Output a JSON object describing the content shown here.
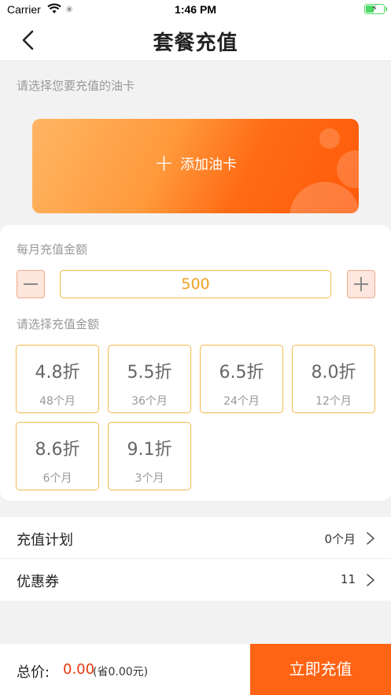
{
  "status_bar": {
    "carrier": "Carrier",
    "time": "1:46 PM"
  },
  "navbar": {
    "title": "套餐充值"
  },
  "card_section": {
    "hint": "请选择您要充值的油卡",
    "add_card_label": "添加油卡"
  },
  "amount_panel": {
    "monthly_label": "每月充值金额",
    "amount_value": "500",
    "choose_label": "请选择充值金额",
    "options": [
      {
        "rate": "4.8折",
        "months": "48个月"
      },
      {
        "rate": "5.5折",
        "months": "36个月"
      },
      {
        "rate": "6.5折",
        "months": "24个月"
      },
      {
        "rate": "8.0折",
        "months": "12个月"
      },
      {
        "rate": "8.6折",
        "months": "6个月"
      },
      {
        "rate": "9.1折",
        "months": "3个月"
      }
    ]
  },
  "list": {
    "plan_label": "充值计划",
    "plan_value": "0个月",
    "coupon_label": "优惠券",
    "coupon_value": "11"
  },
  "bottom_bar": {
    "total_label": "总价:",
    "total_price": "0.00",
    "savings": "(省0.00元)",
    "recharge_button": "立即充值"
  },
  "colors": {
    "accent": "#ff6314",
    "price_red": "#e8380d",
    "option_border": "#f5b84c",
    "amount_text": "#f0a020"
  },
  "icons": {
    "back": "chevron-left-icon",
    "add": "plus-icon",
    "stepper_minus": "minus-icon",
    "stepper_plus": "plus-icon",
    "row_arrow": "chevron-right-icon",
    "wifi": "wifi-icon",
    "battery": "battery-charging-icon"
  }
}
